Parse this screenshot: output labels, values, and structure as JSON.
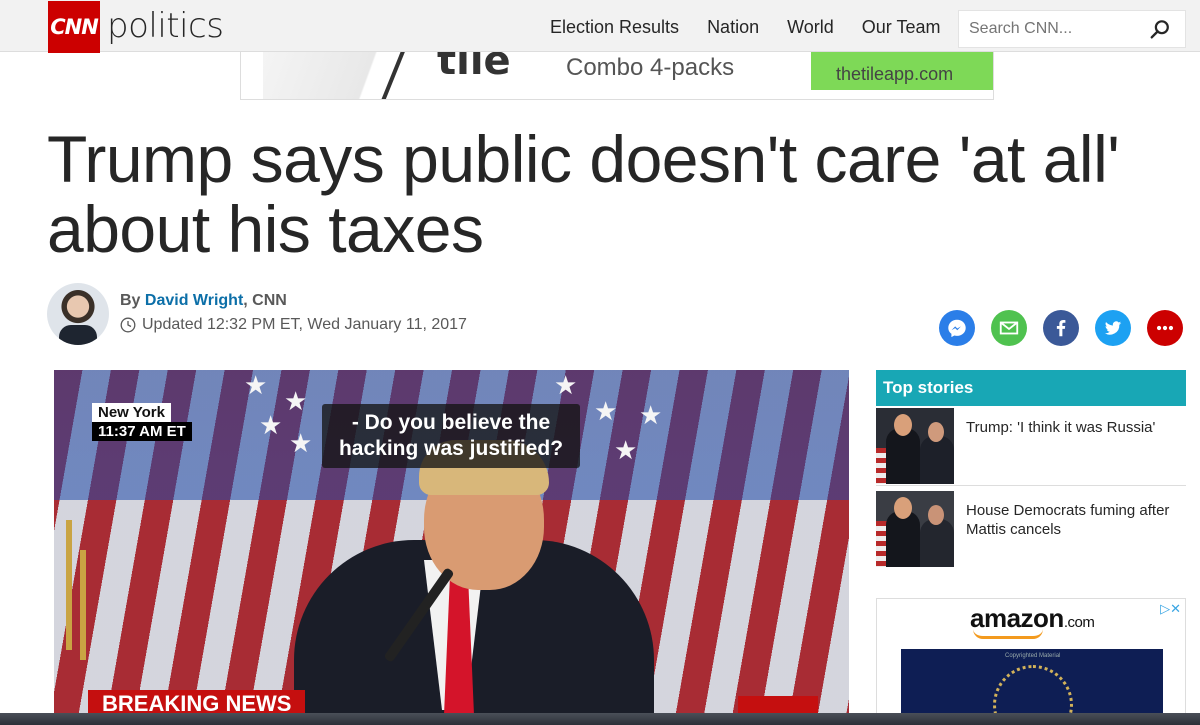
{
  "header": {
    "logo_text": "CNN",
    "section": "politics",
    "nav": [
      "Election Results",
      "Nation",
      "World",
      "Our Team"
    ],
    "search_placeholder": "Search CNN..."
  },
  "ad": {
    "brand": "tile",
    "tagline": "Combo 4-packs",
    "url": "thetileapp.com"
  },
  "article": {
    "headline": "Trump says public doesn't care 'at all' about his taxes",
    "by_prefix": "By",
    "author": "David Wright",
    "outlet": ", CNN",
    "updated": "Updated 12:32 PM ET, Wed January 11, 2017"
  },
  "share": [
    "messenger-icon",
    "email-icon",
    "facebook-icon",
    "twitter-icon",
    "more-icon"
  ],
  "colors": {
    "cnn_red": "#cc0000",
    "top_stories_teal": "#18a7b5",
    "messenger": "#2b7ee8",
    "email": "#4fc24f",
    "facebook": "#3b5998",
    "twitter": "#1da1f2",
    "more": "#cc0000"
  },
  "video": {
    "location": "New York",
    "time": "11:37 AM ET",
    "caption": "- Do you believe the hacking was justified?",
    "banner": "BREAKING NEWS"
  },
  "sidebar": {
    "title": "Top stories",
    "stories": [
      {
        "title": "Trump: 'I think it was Russia'"
      },
      {
        "title": "House Democrats fuming after Mattis cancels"
      }
    ],
    "amazon": {
      "logo": "amazon",
      "logo_suffix": ".com",
      "adchoices": "▷✕",
      "image_note": "Copyrighted Material"
    }
  }
}
